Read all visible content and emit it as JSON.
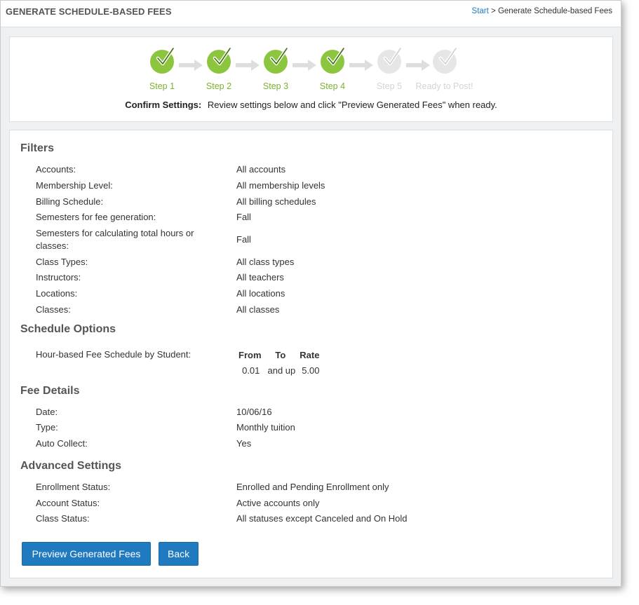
{
  "header": {
    "title": "GENERATE SCHEDULE-BASED FEES",
    "breadcrumb_link": "Start",
    "breadcrumb_sep": ">",
    "breadcrumb_current": "Generate Schedule-based Fees"
  },
  "steps": [
    {
      "label": "Step 1",
      "status": "done"
    },
    {
      "label": "Step 2",
      "status": "done"
    },
    {
      "label": "Step 3",
      "status": "done"
    },
    {
      "label": "Step 4",
      "status": "done"
    },
    {
      "label": "Step 5",
      "status": "pending"
    },
    {
      "label": "Ready to Post!",
      "status": "pending"
    }
  ],
  "confirm": {
    "title": "Confirm Settings:",
    "text": "Review settings below and click \"Preview Generated Fees\" when ready."
  },
  "filters": {
    "heading": "Filters",
    "rows": [
      {
        "label": "Accounts:",
        "value": "All accounts"
      },
      {
        "label": "Membership Level:",
        "value": "All membership levels"
      },
      {
        "label": "Billing Schedule:",
        "value": "All billing schedules"
      },
      {
        "label": "Semesters for fee generation:",
        "value": "Fall"
      },
      {
        "label": "Semesters for calculating total hours or classes:",
        "value": "Fall"
      },
      {
        "label": "Class Types:",
        "value": "All class types"
      },
      {
        "label": "Instructors:",
        "value": "All teachers"
      },
      {
        "label": "Locations:",
        "value": "All locations"
      },
      {
        "label": "Classes:",
        "value": "All classes"
      }
    ]
  },
  "schedule_options": {
    "heading": "Schedule Options",
    "label": "Hour-based Fee Schedule by Student:",
    "columns": [
      "From",
      "To",
      "Rate"
    ],
    "rows": [
      [
        "0.01",
        "and up",
        "5.00"
      ]
    ]
  },
  "fee_details": {
    "heading": "Fee Details",
    "rows": [
      {
        "label": "Date:",
        "value": "10/06/16"
      },
      {
        "label": "Type:",
        "value": "Monthly tuition"
      },
      {
        "label": "Auto Collect:",
        "value": "Yes"
      }
    ]
  },
  "advanced": {
    "heading": "Advanced Settings",
    "rows": [
      {
        "label": "Enrollment Status:",
        "value": "Enrolled and Pending Enrollment only"
      },
      {
        "label": "Account Status:",
        "value": "Active accounts only"
      },
      {
        "label": "Class Status:",
        "value": "All statuses except Canceled and On Hold"
      }
    ]
  },
  "buttons": {
    "preview": "Preview Generated Fees",
    "back": "Back"
  },
  "colors": {
    "accent": "#1f7abf",
    "step_done": "#8cc63f",
    "step_pending": "#e6e6e6"
  }
}
